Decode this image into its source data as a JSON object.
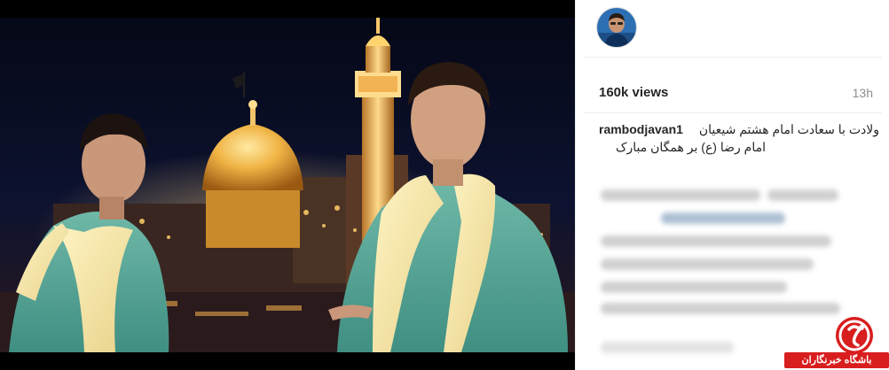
{
  "post": {
    "username": "rambodjavan1",
    "views": "160k views",
    "time": "13h",
    "caption_line1": "ولادت با سعادت امام هشتم شیعیان",
    "caption_line2": "امام رضا (ع) بر همگان مبارک"
  },
  "watermark": {
    "text": "باشگاه خبرنگاران"
  },
  "colors": {
    "brand_red": "#d81e1e",
    "text_primary": "#262626",
    "text_secondary": "#8e8e8e"
  },
  "icons": {
    "video": "video-thumbnail",
    "avatar": "profile-avatar",
    "watermark": "club-logo-icon"
  }
}
